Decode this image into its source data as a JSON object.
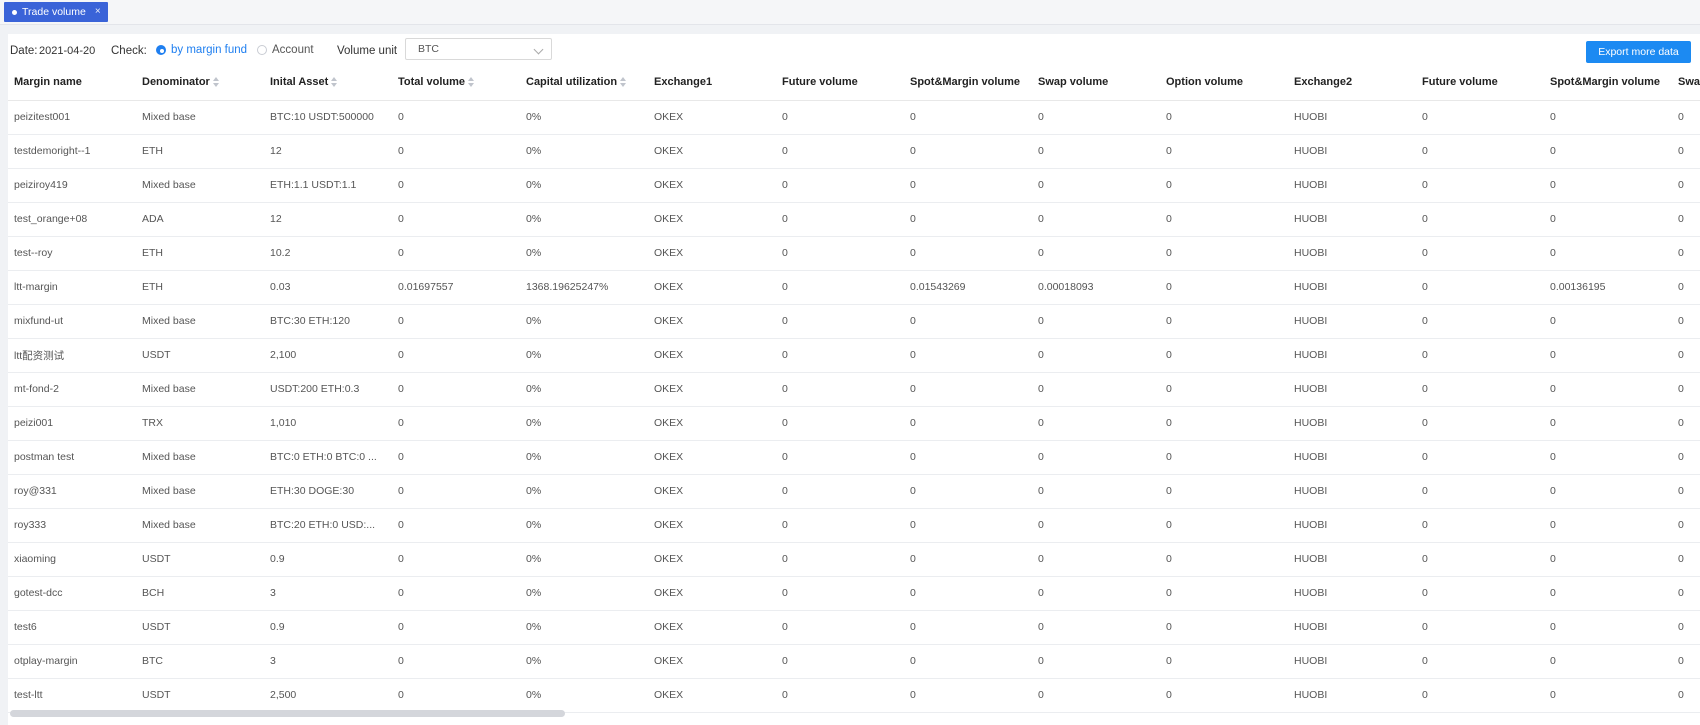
{
  "tab": {
    "label": "Trade volume",
    "close": "×"
  },
  "toolbar": {
    "date_label": "Date:",
    "date_value": "2021-04-20",
    "check_label": "Check:",
    "check_options": [
      "by margin fund",
      "Account"
    ],
    "check_selected": "by margin fund",
    "unit_label": "Volume unit",
    "unit_value": "BTC",
    "export_label": "Export more data"
  },
  "table": {
    "columns": [
      "Margin name",
      "Denominator",
      "Inital Asset",
      "Total volume",
      "Capital utilization",
      "Exchange1",
      "Future volume",
      "Spot&Margin volume",
      "Swap volume",
      "Option volume",
      "Exchange2",
      "Future volume",
      "Spot&Margin volume",
      "Swap volume"
    ],
    "sortable": [
      false,
      true,
      true,
      true,
      true,
      false,
      false,
      false,
      false,
      false,
      false,
      false,
      false,
      false
    ],
    "rows": [
      [
        "peizitest001",
        "Mixed base",
        "BTC:10 USDT:500000",
        "0",
        "0%",
        "OKEX",
        "0",
        "0",
        "0",
        "0",
        "HUOBI",
        "0",
        "0",
        "0"
      ],
      [
        "testdemoright--1",
        "ETH",
        "12",
        "0",
        "0%",
        "OKEX",
        "0",
        "0",
        "0",
        "0",
        "HUOBI",
        "0",
        "0",
        "0"
      ],
      [
        "peiziroy419",
        "Mixed base",
        "ETH:1.1 USDT:1.1",
        "0",
        "0%",
        "OKEX",
        "0",
        "0",
        "0",
        "0",
        "HUOBI",
        "0",
        "0",
        "0"
      ],
      [
        "test_orange+08",
        "ADA",
        "12",
        "0",
        "0%",
        "OKEX",
        "0",
        "0",
        "0",
        "0",
        "HUOBI",
        "0",
        "0",
        "0"
      ],
      [
        "test--roy",
        "ETH",
        "10.2",
        "0",
        "0%",
        "OKEX",
        "0",
        "0",
        "0",
        "0",
        "HUOBI",
        "0",
        "0",
        "0"
      ],
      [
        "ltt-margin",
        "ETH",
        "0.03",
        "0.01697557",
        "1368.19625247%",
        "OKEX",
        "0",
        "0.01543269",
        "0.00018093",
        "0",
        "HUOBI",
        "0",
        "0.00136195",
        "0"
      ],
      [
        "mixfund-ut",
        "Mixed base",
        "BTC:30 ETH:120",
        "0",
        "0%",
        "OKEX",
        "0",
        "0",
        "0",
        "0",
        "HUOBI",
        "0",
        "0",
        "0"
      ],
      [
        "ltt配资测试",
        "USDT",
        "2,100",
        "0",
        "0%",
        "OKEX",
        "0",
        "0",
        "0",
        "0",
        "HUOBI",
        "0",
        "0",
        "0"
      ],
      [
        "mt-fond-2",
        "Mixed base",
        "USDT:200 ETH:0.3",
        "0",
        "0%",
        "OKEX",
        "0",
        "0",
        "0",
        "0",
        "HUOBI",
        "0",
        "0",
        "0"
      ],
      [
        "peizi001",
        "TRX",
        "1,010",
        "0",
        "0%",
        "OKEX",
        "0",
        "0",
        "0",
        "0",
        "HUOBI",
        "0",
        "0",
        "0"
      ],
      [
        "postman test",
        "Mixed base",
        "BTC:0 ETH:0 BTC:0 ...",
        "0",
        "0%",
        "OKEX",
        "0",
        "0",
        "0",
        "0",
        "HUOBI",
        "0",
        "0",
        "0"
      ],
      [
        "roy@331",
        "Mixed base",
        "ETH:30 DOGE:30",
        "0",
        "0%",
        "OKEX",
        "0",
        "0",
        "0",
        "0",
        "HUOBI",
        "0",
        "0",
        "0"
      ],
      [
        "roy333",
        "Mixed base",
        "BTC:20 ETH:0 USD:...",
        "0",
        "0%",
        "OKEX",
        "0",
        "0",
        "0",
        "0",
        "HUOBI",
        "0",
        "0",
        "0"
      ],
      [
        "xiaoming",
        "USDT",
        "0.9",
        "0",
        "0%",
        "OKEX",
        "0",
        "0",
        "0",
        "0",
        "HUOBI",
        "0",
        "0",
        "0"
      ],
      [
        "gotest-dcc",
        "BCH",
        "3",
        "0",
        "0%",
        "OKEX",
        "0",
        "0",
        "0",
        "0",
        "HUOBI",
        "0",
        "0",
        "0"
      ],
      [
        "test6",
        "USDT",
        "0.9",
        "0",
        "0%",
        "OKEX",
        "0",
        "0",
        "0",
        "0",
        "HUOBI",
        "0",
        "0",
        "0"
      ],
      [
        "otplay-margin",
        "BTC",
        "3",
        "0",
        "0%",
        "OKEX",
        "0",
        "0",
        "0",
        "0",
        "HUOBI",
        "0",
        "0",
        "0"
      ],
      [
        "test-ltt",
        "USDT",
        "2,500",
        "0",
        "0%",
        "OKEX",
        "0",
        "0",
        "0",
        "0",
        "HUOBI",
        "0",
        "0",
        "0"
      ]
    ]
  },
  "colors": {
    "accent": "#1c8af2",
    "tab": "#3a63d8"
  }
}
